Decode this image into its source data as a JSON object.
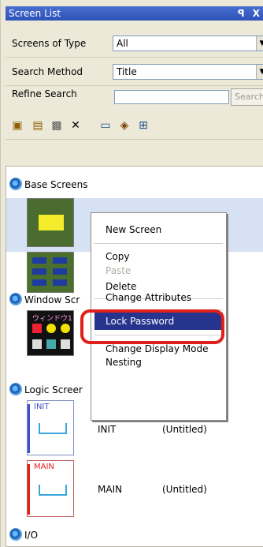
{
  "panel": {
    "title": "Screen List",
    "title_buttons": "ꟼ X"
  },
  "filters": {
    "type_label": "Screens of Type",
    "type_value": "All",
    "method_label": "Search Method",
    "method_value": "Title",
    "refine_label": "Refine Search",
    "refine_placeholder": "",
    "search_button": "Search"
  },
  "toolbar": {
    "icons": [
      "new-screen-icon",
      "new-window-icon",
      "copy-icon",
      "delete-icon",
      "display-icon",
      "properties-icon",
      "nesting-icon"
    ]
  },
  "tree": {
    "base_screens": "Base Screens",
    "window_screens": "Window Scr",
    "window_thumb_text": "ウィンドウ1",
    "logic_screens": "Logic Screer",
    "io": "I/O",
    "logic_items": [
      {
        "thumb_label": "INIT",
        "name": "INIT",
        "title": "(Untitled)"
      },
      {
        "thumb_label": "MAIN",
        "name": "MAIN",
        "title": "(Untitled)"
      }
    ]
  },
  "context_menu": {
    "items": [
      {
        "label": "New Screen",
        "disabled": false
      },
      {
        "label": "Copy",
        "disabled": false
      },
      {
        "label": "Paste",
        "disabled": true
      },
      {
        "label": "Delete",
        "disabled": false
      },
      {
        "label": "Change Attributes",
        "disabled": false
      },
      {
        "label": "Lock Password",
        "disabled": false,
        "highlighted": true
      },
      {
        "label": "Change Display Mode",
        "disabled": false
      },
      {
        "label": "Nesting",
        "disabled": false
      }
    ]
  },
  "colors": {
    "highlight": "#27348e",
    "annotation_ring": "#e0201a",
    "titlebar": "#2d52b8"
  }
}
